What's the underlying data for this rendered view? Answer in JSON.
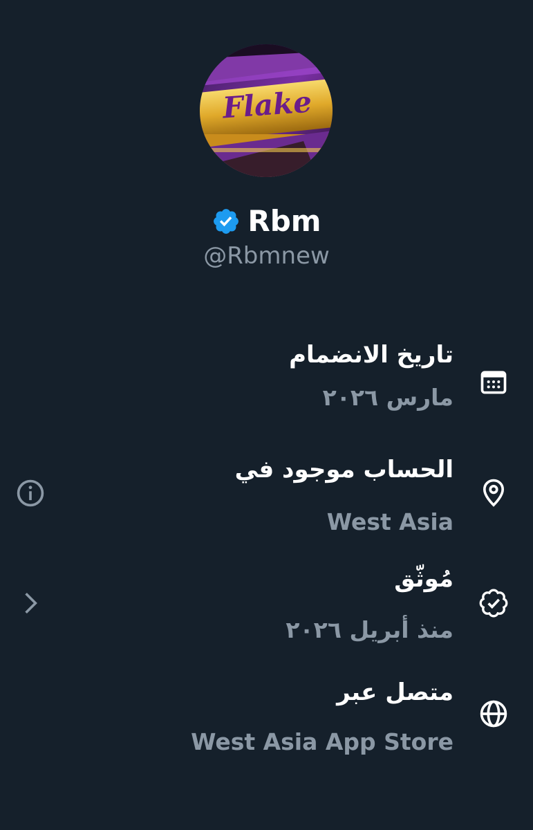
{
  "profile": {
    "display_name": "Rbm",
    "handle": "@Rbmnew",
    "avatar_text": "Flake",
    "verified_color": "#1d9bf0"
  },
  "rows": [
    {
      "title": "تاريخ الانضمام",
      "value": "مارس ٢٠٢٦",
      "icon": "calendar-icon"
    },
    {
      "title": "الحساب موجود في",
      "value": "West Asia",
      "icon": "location-pin-icon"
    },
    {
      "title": "مُوثّق",
      "value": "منذ أبريل ٢٠٢٦",
      "icon": "verified-badge-icon"
    },
    {
      "title": "متصل عبر",
      "value": "West Asia App Store",
      "icon": "globe-icon"
    }
  ],
  "side_icons": [
    "info-icon",
    "chevron-right-icon"
  ],
  "colors": {
    "background": "#15202b",
    "primary_text": "#ffffff",
    "secondary_text": "#8b98a5"
  }
}
